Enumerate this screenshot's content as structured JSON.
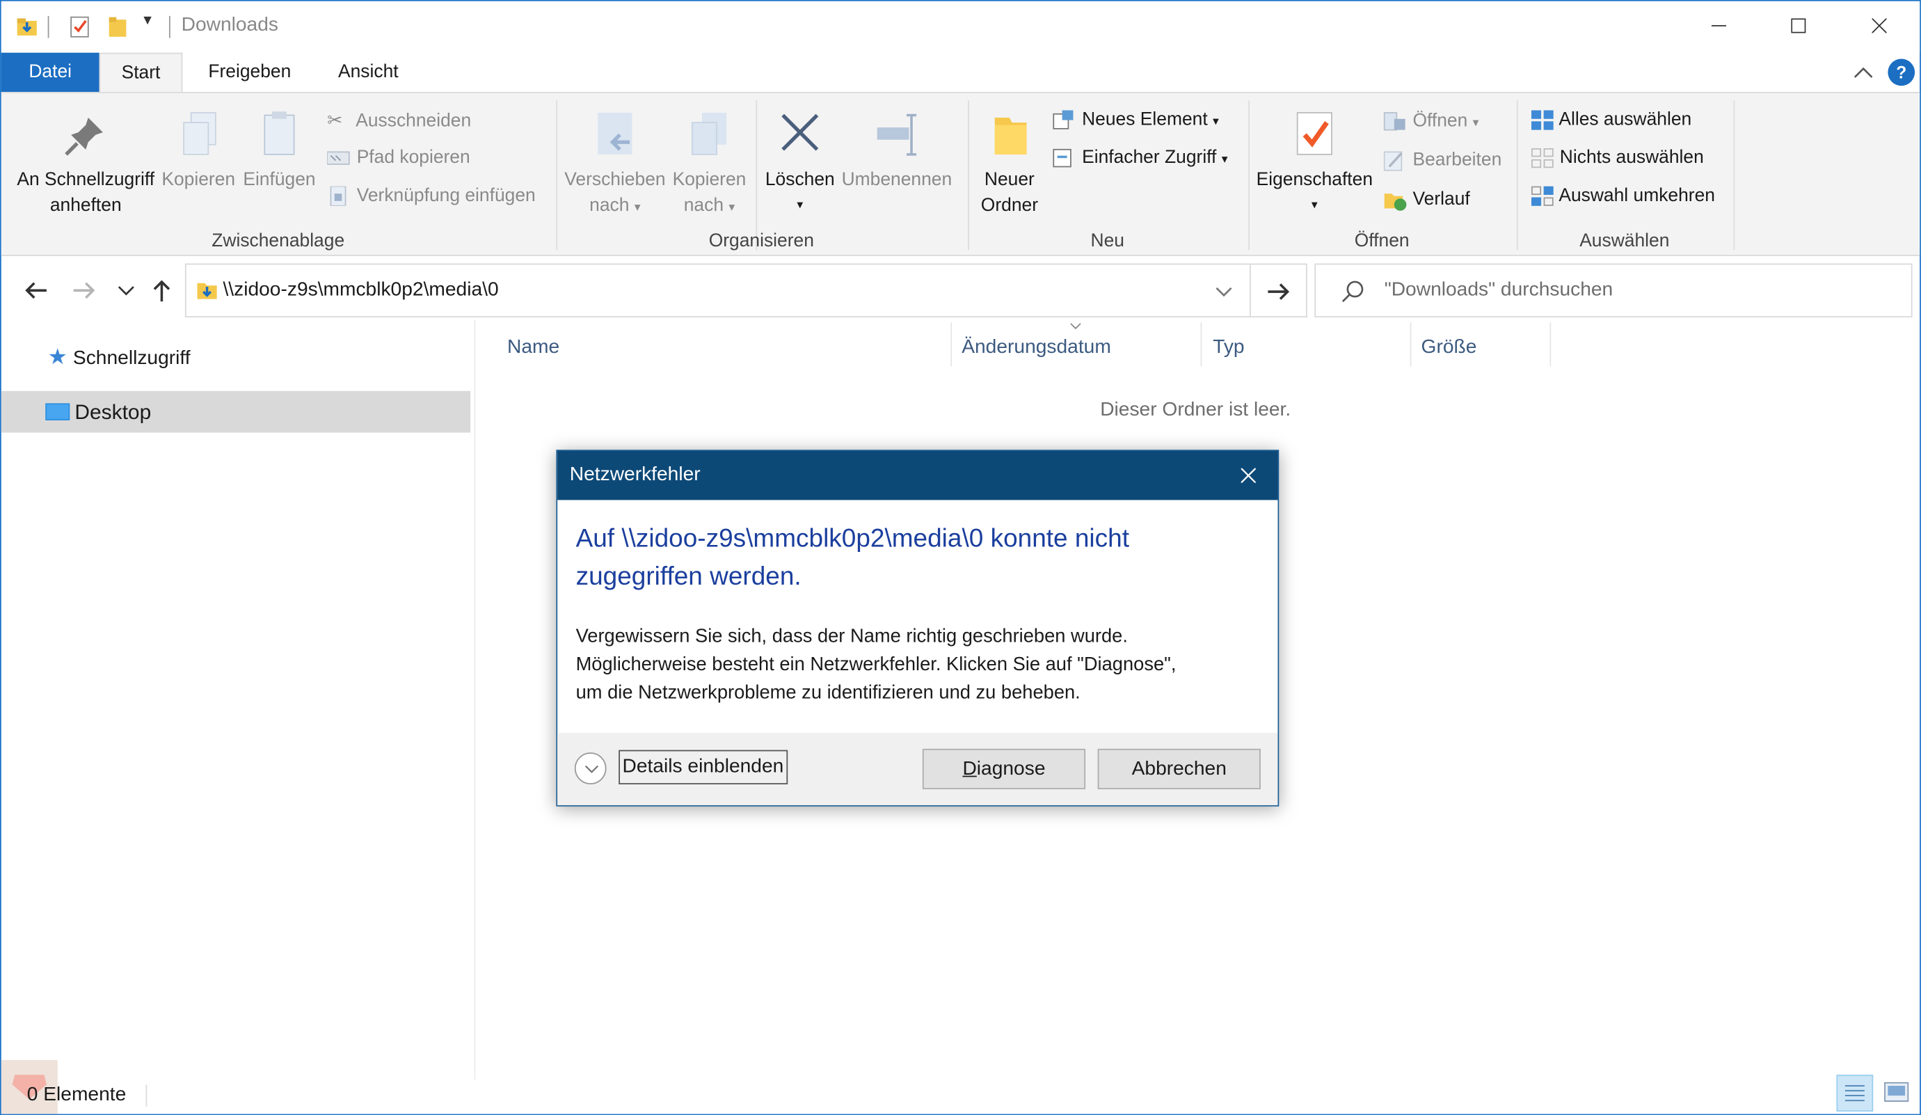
{
  "window": {
    "title": "Downloads"
  },
  "tabs": {
    "datei": "Datei",
    "start": "Start",
    "freigeben": "Freigeben",
    "ansicht": "Ansicht"
  },
  "ribbon": {
    "zwischenablage": {
      "label": "Zwischenablage",
      "pin_line1": "An Schnellzugriff",
      "pin_line2": "anheften",
      "kopieren": "Kopieren",
      "einfuegen": "Einfügen",
      "ausschneiden": "Ausschneiden",
      "pfad_kopieren": "Pfad kopieren",
      "verknuepfung": "Verknüpfung einfügen"
    },
    "organisieren": {
      "label": "Organisieren",
      "verschieben_line1": "Verschieben",
      "verschieben_line2": "nach",
      "kopieren_line1": "Kopieren",
      "kopieren_line2": "nach",
      "loeschen": "Löschen",
      "umbenennen": "Umbenennen"
    },
    "neu": {
      "label": "Neu",
      "ordner_line1": "Neuer",
      "ordner_line2": "Ordner",
      "neues_element": "Neues Element",
      "einfacher_zugriff": "Einfacher Zugriff"
    },
    "oeffnen": {
      "label": "Öffnen",
      "eigenschaften": "Eigenschaften",
      "oeffnen": "Öffnen",
      "bearbeiten": "Bearbeiten",
      "verlauf": "Verlauf"
    },
    "auswaehlen": {
      "label": "Auswählen",
      "alles": "Alles auswählen",
      "nichts": "Nichts auswählen",
      "umkehren": "Auswahl umkehren"
    }
  },
  "address": {
    "path": "\\\\zidoo-z9s\\mmcblk0p2\\media\\0"
  },
  "search": {
    "placeholder": "\"Downloads\" durchsuchen"
  },
  "nav": {
    "quick_access": "Schnellzugriff",
    "desktop": "Desktop"
  },
  "columns": {
    "name": "Name",
    "date": "Änderungsdatum",
    "type": "Typ",
    "size": "Größe"
  },
  "content": {
    "empty": "Dieser Ordner ist leer."
  },
  "dialog": {
    "title": "Netzwerkfehler",
    "heading_line1": "Auf \\\\zidoo-z9s\\mmcblk0p2\\media\\0 konnte nicht",
    "heading_line2": "zugegriffen werden.",
    "body_line1": "Vergewissern Sie sich, dass der Name richtig geschrieben wurde.",
    "body_line2": "Möglicherweise besteht ein Netzwerkfehler. Klicken Sie auf \"Diagnose\",",
    "body_line3": "um die Netzwerkprobleme zu identifizieren und zu beheben.",
    "details": "Details einblenden",
    "diagnose_first": "D",
    "diagnose_rest": "iagnose",
    "abbrechen": "Abbrechen"
  },
  "status": {
    "count": "0 Elemente"
  },
  "colors": {
    "accent": "#1b6ec2",
    "dialog_title": "#0d4977",
    "dialog_heading": "#1b3f9e"
  }
}
